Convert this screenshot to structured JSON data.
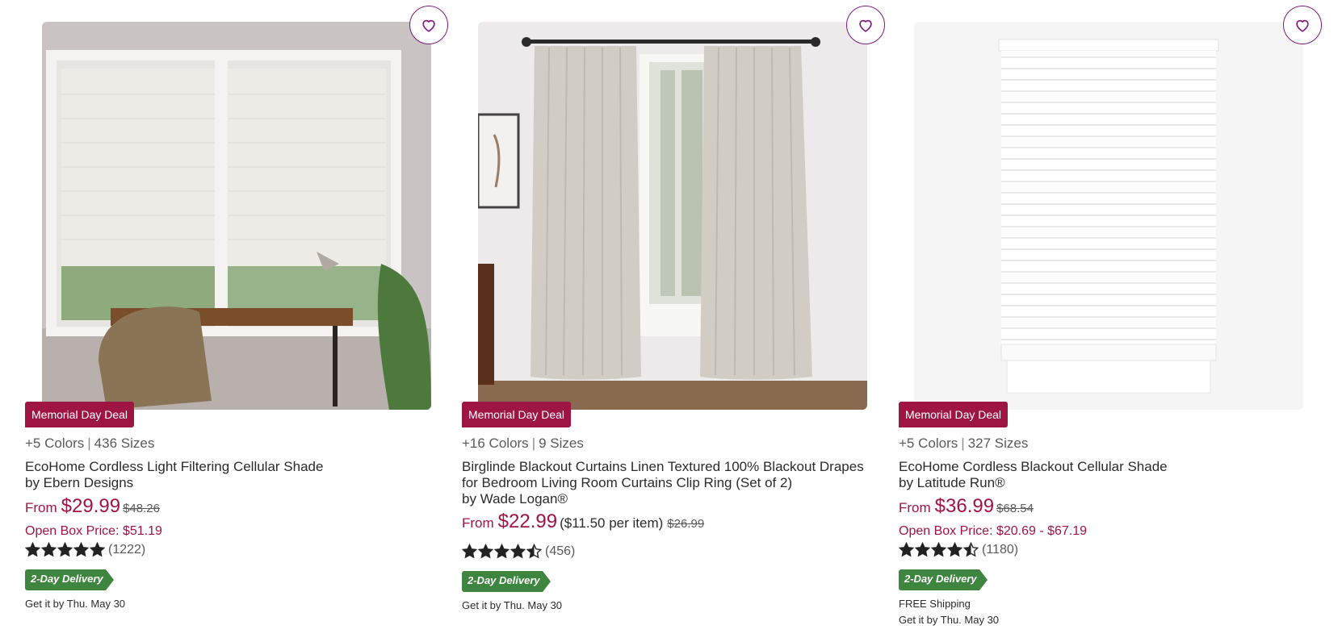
{
  "products": [
    {
      "deal": "Memorial Day Deal",
      "colors": "+5 Colors",
      "sizes": "436 Sizes",
      "name": "EcoHome Cordless Light Filtering Cellular Shade",
      "brand": "by Ebern Designs",
      "price_prefix": "From",
      "price": "$29.99",
      "per_item": "",
      "old_price": "$48.26",
      "open_box": "Open Box Price: $51.19",
      "rating": 5,
      "reviews": "(1222)",
      "delivery_badge": "2-Day Delivery",
      "free_shipping": "",
      "delivery_date": "Get it by Thu. May 30",
      "image_icon": "roller-shade-office-photo"
    },
    {
      "deal": "Memorial Day Deal",
      "colors": "+16 Colors",
      "sizes": "9 Sizes",
      "name": "Birglinde Blackout Curtains Linen Textured 100% Blackout Drapes for Bedroom Living Room Curtains Clip Ring (Set of 2)",
      "brand": "by Wade Logan®",
      "price_prefix": "From",
      "price": "$22.99",
      "per_item": "($11.50 per item)",
      "old_price": "$26.99",
      "open_box": "",
      "rating": 4.5,
      "reviews": "(456)",
      "delivery_badge": "2-Day Delivery",
      "free_shipping": "",
      "delivery_date": "Get it by Thu. May 30",
      "image_icon": "linen-curtains-photo"
    },
    {
      "deal": "Memorial Day Deal",
      "colors": "+5 Colors",
      "sizes": "327 Sizes",
      "name": "EcoHome Cordless Blackout Cellular Shade",
      "brand": "by Latitude Run®",
      "price_prefix": "From",
      "price": "$36.99",
      "per_item": "",
      "old_price": "$68.54",
      "open_box": "Open Box Price: $20.69 - $67.19",
      "rating": 4.5,
      "reviews": "(1180)",
      "delivery_badge": "2-Day Delivery",
      "free_shipping": "FREE Shipping",
      "delivery_date": "Get it by Thu. May 30",
      "image_icon": "cellular-shade-product-photo"
    }
  ],
  "colors": {
    "deal_bg": "#9e1443",
    "price": "#9e1443",
    "favorite_border": "#7f187f",
    "delivery_badge": "#3e8540",
    "star": "#222222"
  }
}
